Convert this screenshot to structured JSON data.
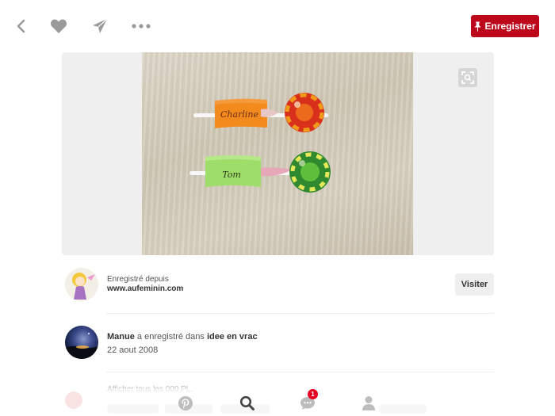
{
  "header": {
    "save_label": "Enregistrer",
    "icons": [
      "back-arrow-icon",
      "heart-icon",
      "send-icon",
      "more-icon",
      "pushpin-icon"
    ]
  },
  "pin_image": {
    "labels": [
      "Charline",
      "Tom"
    ]
  },
  "source": {
    "label": "Enregistré depuis",
    "domain": "www.aufeminin.com",
    "visit_label": "Visiter"
  },
  "pinner": {
    "name": "Manue",
    "action": "a enregistré dans",
    "board": "idee en vrac",
    "date": "22 aout 2008"
  },
  "faded": {
    "text": "Afficher tous les 000 Pl..."
  },
  "nav": {
    "items": [
      "pinterest-logo-icon",
      "search-icon",
      "messages-icon",
      "profile-icon"
    ],
    "message_badge": "1"
  },
  "colors": {
    "accent": "#bd081c",
    "badge": "#e60023",
    "icon_gray": "#9a9a9a"
  }
}
